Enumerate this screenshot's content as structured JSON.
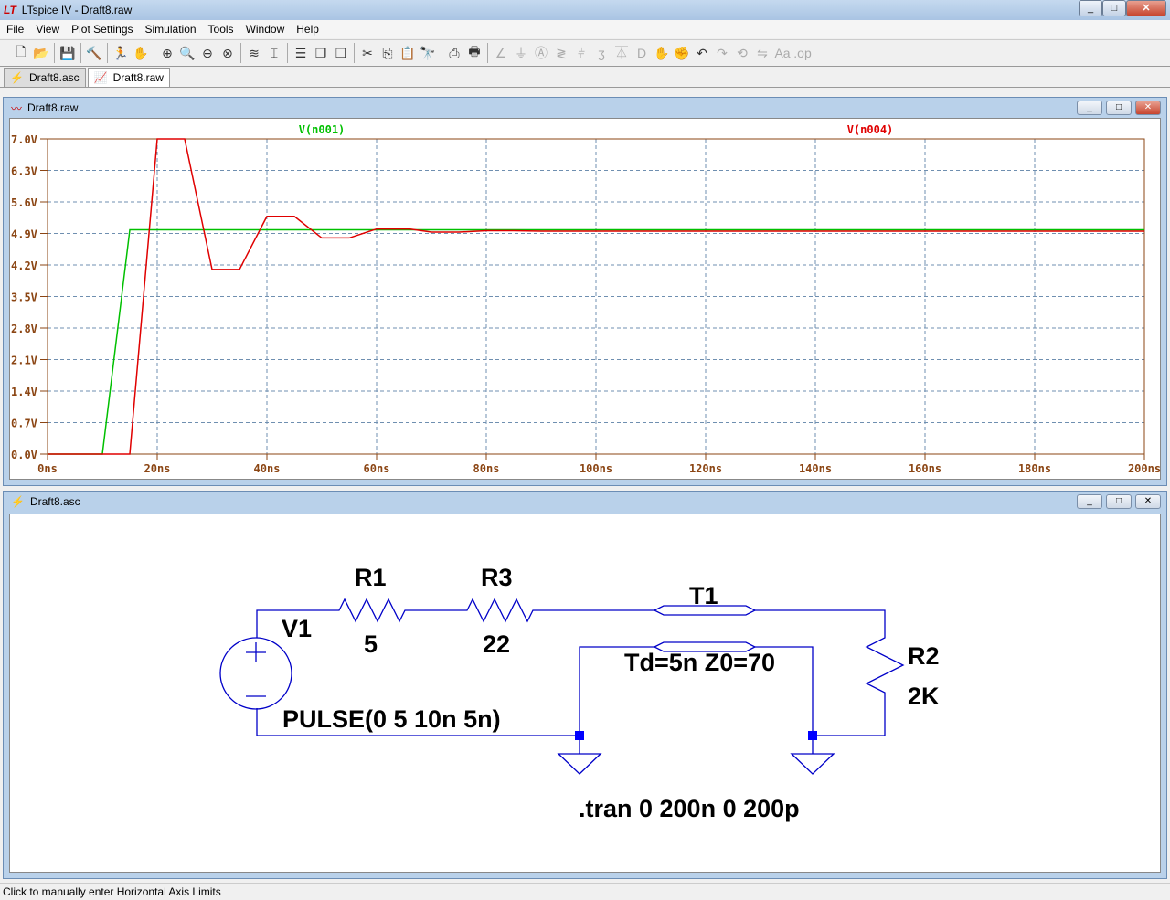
{
  "window": {
    "title": "LTspice IV - Draft8.raw",
    "logo": "LT"
  },
  "menu": [
    "File",
    "View",
    "Plot Settings",
    "Simulation",
    "Tools",
    "Window",
    "Help"
  ],
  "toolbar_icons": [
    "new-schematic",
    "open",
    "save",
    "control-panel",
    "run",
    "halt",
    "zoom-in",
    "zoom-pan",
    "zoom-out",
    "zoom-cancel",
    "autorange",
    "mark-unconnected",
    "tile-horizontal",
    "cascade",
    "tile-vertical",
    "cut",
    "copy",
    "paste",
    "find",
    "print-setup",
    "print",
    "wire",
    "ground",
    "label",
    "resistor",
    "capacitor",
    "inductor",
    "diode",
    "component",
    "move",
    "drag",
    "undo",
    "redo",
    "rotate",
    "mirror",
    "text",
    "spice-directive"
  ],
  "tabs": [
    {
      "label": "Draft8.asc",
      "active": false
    },
    {
      "label": "Draft8.raw",
      "active": true
    }
  ],
  "plot_window": {
    "title": "Draft8.raw"
  },
  "schematic_window": {
    "title": "Draft8.asc"
  },
  "chart_data": {
    "type": "line",
    "xlabel": "",
    "ylabel": "",
    "xlim": [
      0,
      200
    ],
    "ylim": [
      0,
      7
    ],
    "xticks": [
      "0ns",
      "20ns",
      "40ns",
      "60ns",
      "80ns",
      "100ns",
      "120ns",
      "140ns",
      "160ns",
      "180ns",
      "200ns"
    ],
    "yticks": [
      "0.0V",
      "0.7V",
      "1.4V",
      "2.1V",
      "2.8V",
      "3.5V",
      "4.2V",
      "4.9V",
      "5.6V",
      "6.3V",
      "7.0V"
    ],
    "grid": true,
    "series": [
      {
        "name": "V(n001)",
        "color": "#00c000",
        "x": [
          0,
          10,
          15,
          200
        ],
        "y": [
          0,
          0,
          4.98,
          4.98
        ]
      },
      {
        "name": "V(n004)",
        "color": "#e00000",
        "x": [
          0,
          15,
          20,
          25,
          30,
          35,
          40,
          45,
          50,
          55,
          60,
          65,
          66,
          70,
          75,
          80,
          85,
          90,
          200
        ],
        "y": [
          0,
          0,
          7,
          7,
          4.1,
          4.1,
          5.28,
          5.28,
          4.8,
          4.8,
          5.0,
          5.0,
          5.0,
          4.93,
          4.93,
          4.96,
          4.96,
          4.95,
          4.95
        ]
      }
    ]
  },
  "schematic": {
    "V1": {
      "name": "V1",
      "value": "PULSE(0 5 10n 5n)"
    },
    "R1": {
      "name": "R1",
      "value": "5"
    },
    "R3": {
      "name": "R3",
      "value": "22"
    },
    "T1": {
      "name": "T1",
      "value": "Td=5n Z0=70"
    },
    "R2": {
      "name": "R2",
      "value": "2K"
    },
    "directive": ".tran 0 200n 0 200p"
  },
  "status": "Click to manually enter Horizontal Axis Limits"
}
